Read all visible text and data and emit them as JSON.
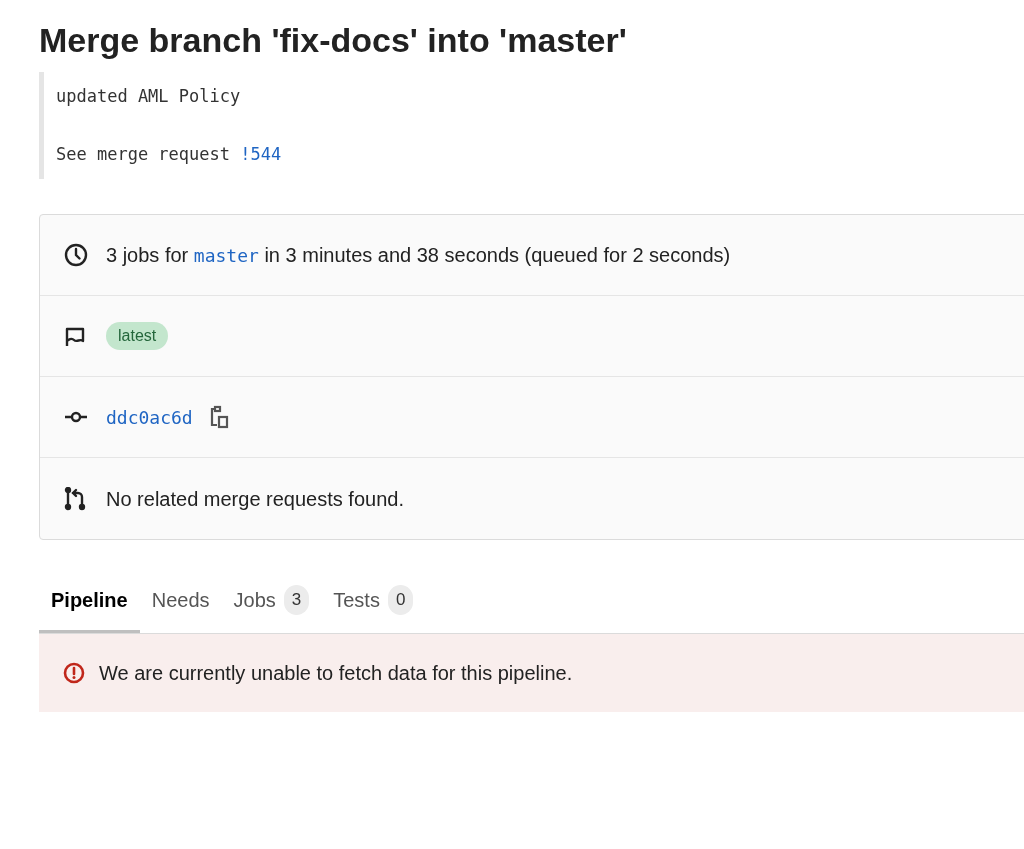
{
  "title": "Merge branch 'fix-docs' into 'master'",
  "description": {
    "line": "updated AML Policy",
    "mr_prefix": "See merge request ",
    "mr_link": "!544"
  },
  "info_rows": [
    {
      "kind": "jobs",
      "prefix": "3 jobs for ",
      "branch": "master",
      "suffix": " in 3 minutes and 38 seconds (queued for 2 seconds)"
    },
    {
      "kind": "badges",
      "badges": [
        "latest"
      ]
    },
    {
      "kind": "commit",
      "sha": "ddc0ac6d"
    },
    {
      "kind": "mrs",
      "text": "No related merge requests found."
    }
  ],
  "tabs": [
    {
      "label": "Pipeline",
      "selected": true
    },
    {
      "label": "Needs",
      "selected": false
    },
    {
      "label": "Jobs",
      "count": "3",
      "selected": false
    },
    {
      "label": "Tests",
      "count": "0",
      "selected": false
    }
  ],
  "alert": {
    "text": "We are currently unable to fetch data for this pipeline."
  }
}
